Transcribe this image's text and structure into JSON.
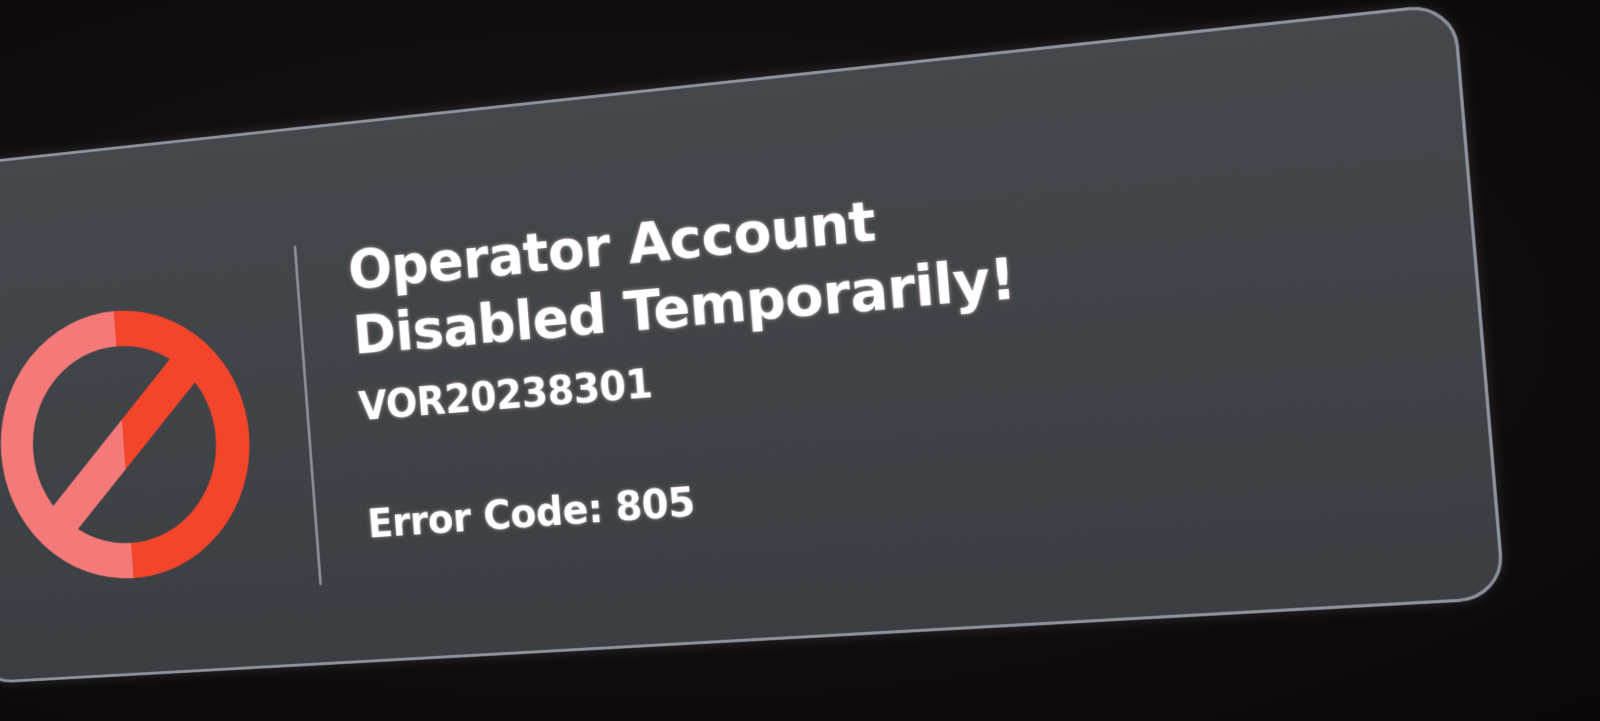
{
  "dialog": {
    "title": "Operator Account Disabled Temporarily!",
    "account_id": "VOR20238301",
    "error_code": "Error Code: 805",
    "icon": "prohibited-icon"
  },
  "colors": {
    "card_background": "#414448",
    "card_border": "#8e939b",
    "icon_red": "#f2452b",
    "icon_pink": "#f47a7a",
    "text": "#ffffff"
  }
}
